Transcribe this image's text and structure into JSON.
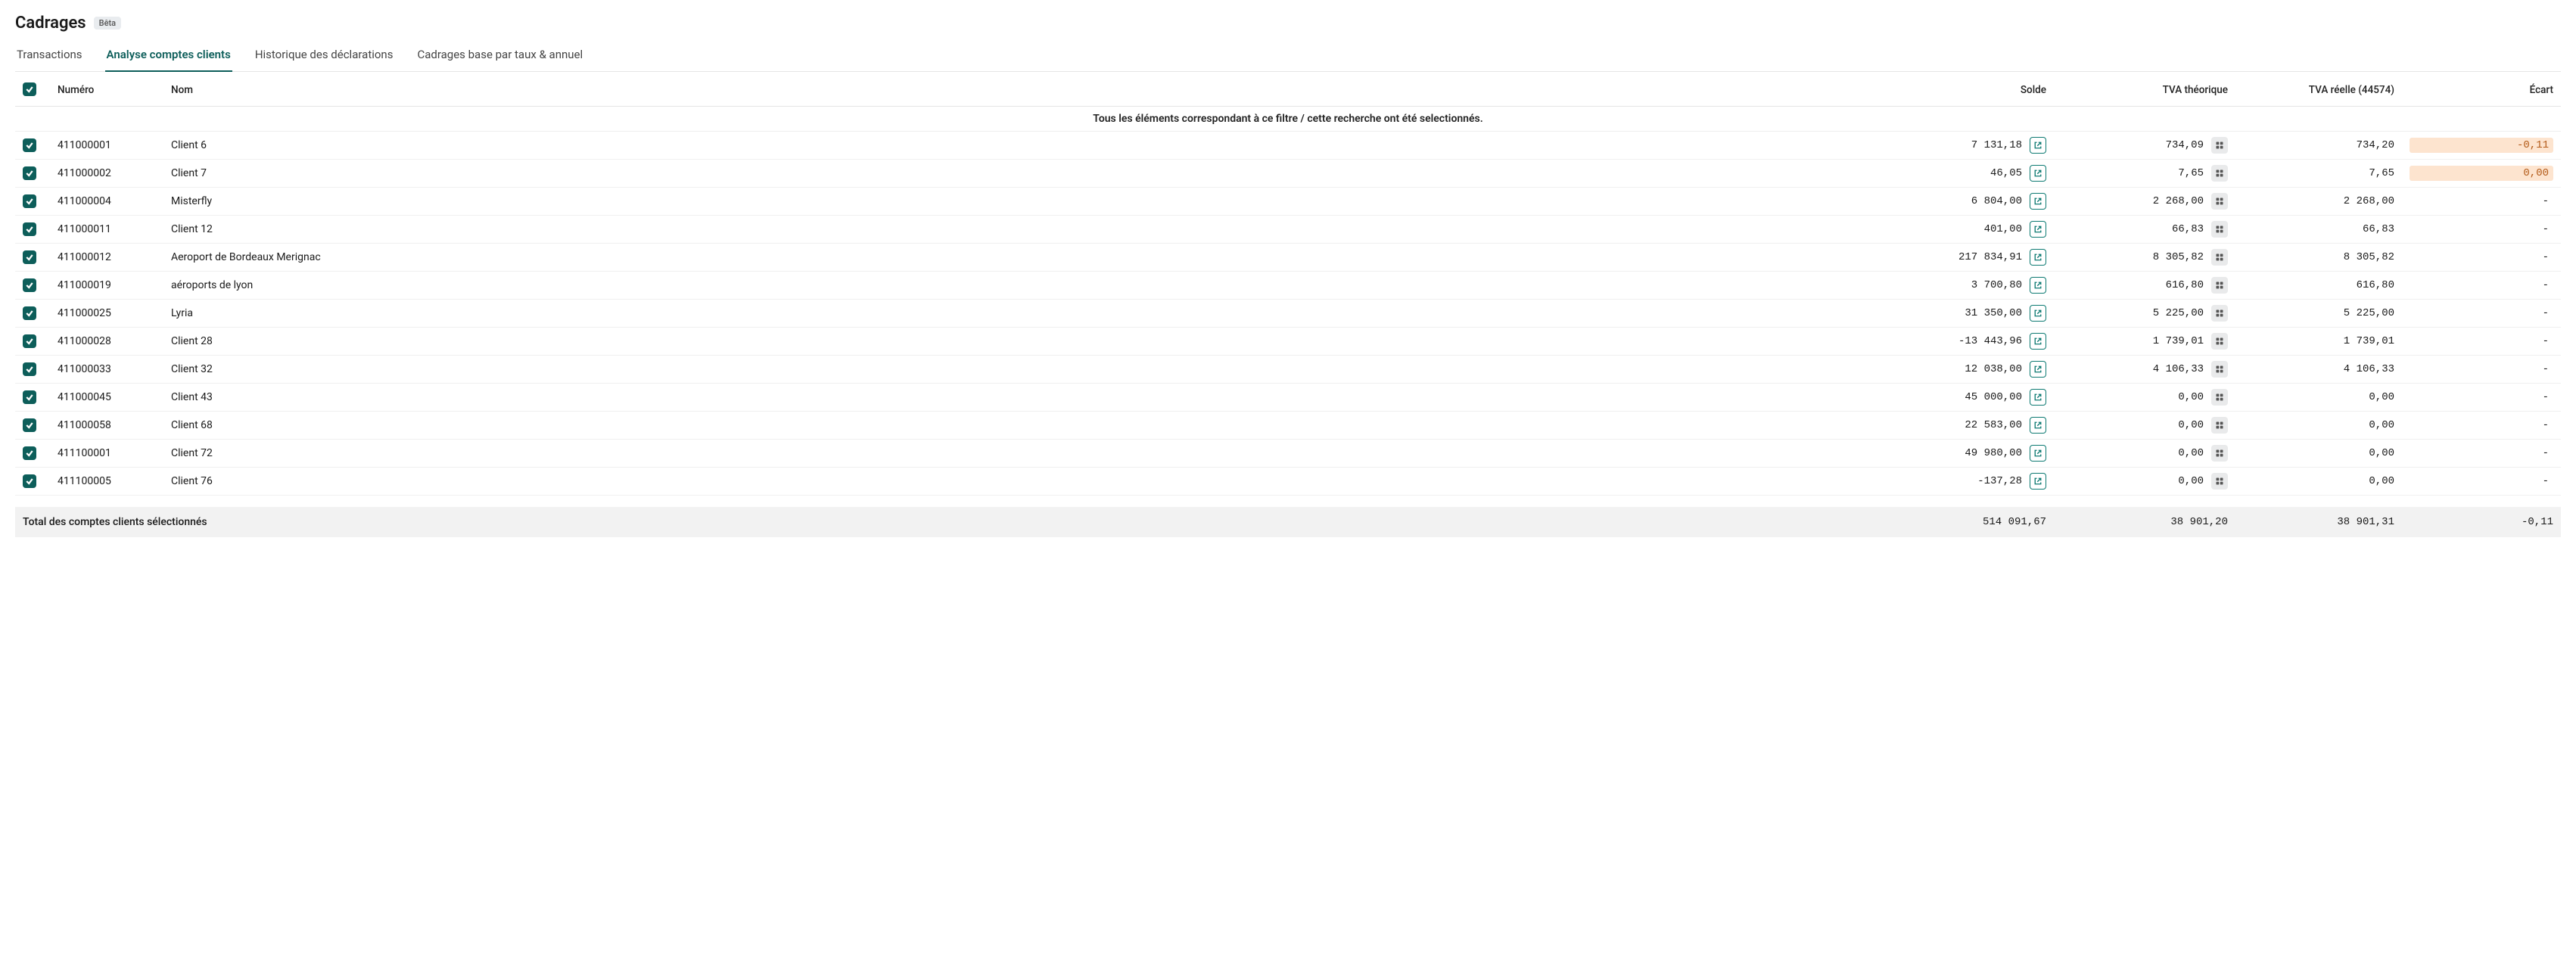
{
  "header": {
    "title": "Cadrages",
    "badge": "Bêta"
  },
  "tabs": [
    {
      "label": "Transactions",
      "active": false
    },
    {
      "label": "Analyse comptes clients",
      "active": true
    },
    {
      "label": "Historique des déclarations",
      "active": false
    },
    {
      "label": "Cadrages base par taux & annuel",
      "active": false
    }
  ],
  "columns": {
    "numero": "Numéro",
    "nom": "Nom",
    "solde": "Solde",
    "tva_theorique": "TVA théorique",
    "tva_reelle": "TVA réelle (44574)",
    "ecart": "Écart"
  },
  "filter_banner": "Tous les éléments correspondant à ce filtre / cette recherche ont été selectionnés.",
  "rows": [
    {
      "numero": "411000001",
      "nom": "Client 6",
      "solde": "7 131,18",
      "tva_t": "734,09",
      "tva_r": "734,20",
      "ecart": "-0,11",
      "ecart_hl": true
    },
    {
      "numero": "411000002",
      "nom": "Client 7",
      "solde": "46,05",
      "tva_t": "7,65",
      "tva_r": "7,65",
      "ecart": "0,00",
      "ecart_hl": true
    },
    {
      "numero": "411000004",
      "nom": "Misterfly",
      "solde": "6 804,00",
      "tva_t": "2 268,00",
      "tva_r": "2 268,00",
      "ecart": "-",
      "ecart_hl": false
    },
    {
      "numero": "411000011",
      "nom": "Client 12",
      "solde": "401,00",
      "tva_t": "66,83",
      "tva_r": "66,83",
      "ecart": "-",
      "ecart_hl": false
    },
    {
      "numero": "411000012",
      "nom": "Aeroport de Bordeaux Merignac",
      "solde": "217 834,91",
      "tva_t": "8 305,82",
      "tva_r": "8 305,82",
      "ecart": "-",
      "ecart_hl": false
    },
    {
      "numero": "411000019",
      "nom": "aéroports de lyon",
      "solde": "3 700,80",
      "tva_t": "616,80",
      "tva_r": "616,80",
      "ecart": "-",
      "ecart_hl": false
    },
    {
      "numero": "411000025",
      "nom": "Lyria",
      "solde": "31 350,00",
      "tva_t": "5 225,00",
      "tva_r": "5 225,00",
      "ecart": "-",
      "ecart_hl": false
    },
    {
      "numero": "411000028",
      "nom": "Client 28",
      "solde": "-13 443,96",
      "tva_t": "1 739,01",
      "tva_r": "1 739,01",
      "ecart": "-",
      "ecart_hl": false
    },
    {
      "numero": "411000033",
      "nom": "Client 32",
      "solde": "12 038,00",
      "tva_t": "4 106,33",
      "tva_r": "4 106,33",
      "ecart": "-",
      "ecart_hl": false
    },
    {
      "numero": "411000045",
      "nom": "Client 43",
      "solde": "45 000,00",
      "tva_t": "0,00",
      "tva_r": "0,00",
      "ecart": "-",
      "ecart_hl": false
    },
    {
      "numero": "411000058",
      "nom": "Client 68",
      "solde": "22 583,00",
      "tva_t": "0,00",
      "tva_r": "0,00",
      "ecart": "-",
      "ecart_hl": false
    },
    {
      "numero": "411100001",
      "nom": "Client 72",
      "solde": "49 980,00",
      "tva_t": "0,00",
      "tva_r": "0,00",
      "ecart": "-",
      "ecart_hl": false
    },
    {
      "numero": "411100005",
      "nom": "Client 76",
      "solde": "-137,28",
      "tva_t": "0,00",
      "tva_r": "0,00",
      "ecart": "-",
      "ecart_hl": false
    }
  ],
  "total": {
    "label": "Total des comptes clients sélectionnés",
    "solde": "514 091,67",
    "tva_t": "38 901,20",
    "tva_r": "38 901,31",
    "ecart": "-0,11"
  }
}
